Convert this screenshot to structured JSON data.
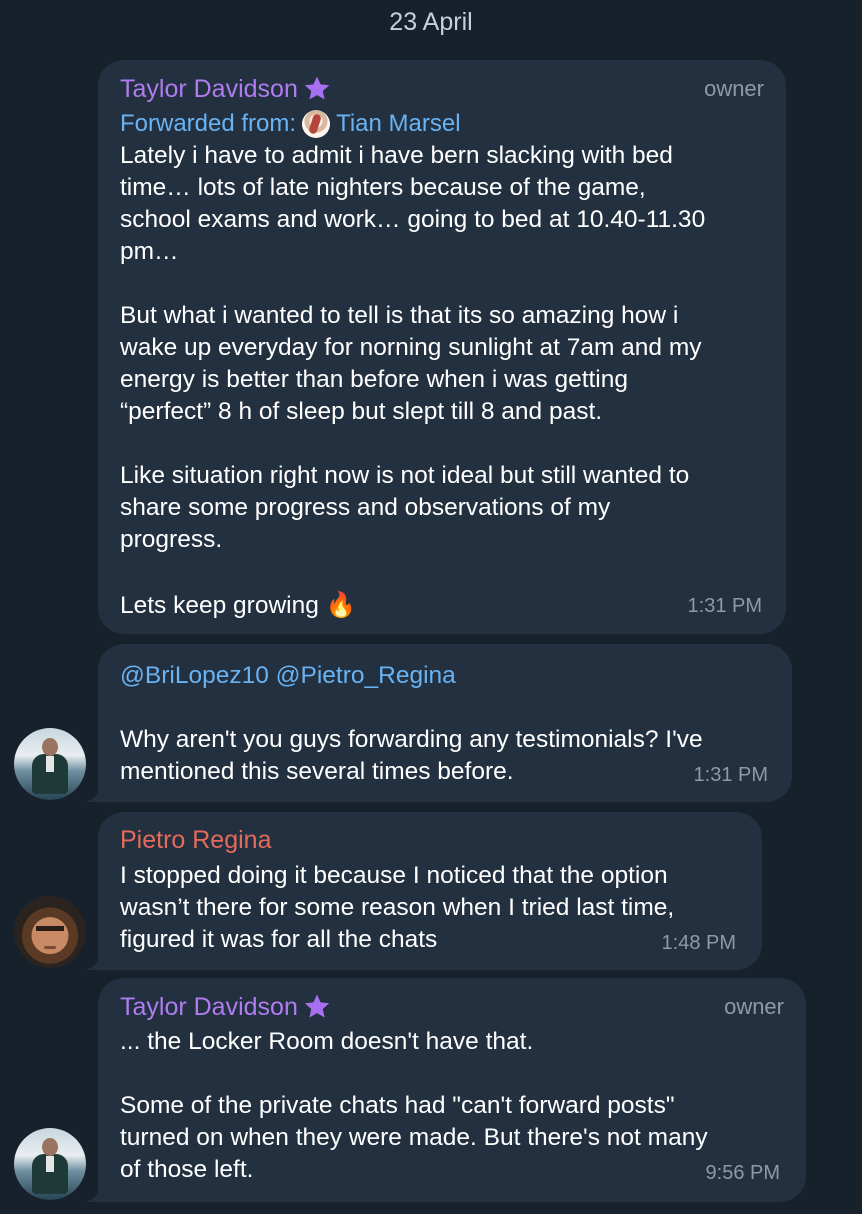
{
  "date_separator": "23 April",
  "messages": [
    {
      "sender": "Taylor Davidson",
      "role": "owner",
      "forwarded_label": "Forwarded from:",
      "forwarded_from": "Tian Marsel",
      "lines": [
        "Lately i have to admit i have bern slacking with  bed",
        "time… lots of late nighters because of the game,",
        "school exams and work… going to bed at 10.40-11.30",
        "pm…",
        "",
        "But what i wanted to tell is that its so amazing how i",
        "wake up everyday for norning sunlight at 7am and my",
        "energy is better than before when i was getting",
        "“perfect” 8 h of sleep but slept till 8 and past.",
        "",
        "Like situation right now is not ideal but still wanted to",
        "share some progress and observations of my",
        "progress.",
        "",
        "Lets keep growing 🔥"
      ],
      "time": "1:31 PM"
    },
    {
      "mentions": "@BriLopez10 @Pietro_Regina",
      "lines": [
        "Why aren't you guys forwarding any testimonials? I've",
        "mentioned this several times before."
      ],
      "time": "1:31 PM"
    },
    {
      "sender": "Pietro Regina",
      "lines": [
        "I stopped doing it because I noticed that the option",
        "wasn’t there for some reason when I tried last time,",
        "figured it was for all the chats"
      ],
      "time": "1:48 PM"
    },
    {
      "sender": "Taylor Davidson",
      "role": "owner",
      "lines": [
        "... the Locker Room doesn't have that.",
        "",
        "Some of the private chats had \"can't forward posts\"",
        "turned on when they were made.  But there's not many",
        "of those left."
      ],
      "time": "9:56 PM"
    }
  ],
  "colors": {
    "background": "#17212b",
    "bubble": "#22303f",
    "owner_name": "#b07cf0",
    "pietro_name": "#e56a5c",
    "link": "#6ab3f3",
    "meta": "#8e9aa6"
  },
  "icons": {
    "badge": "star-icon",
    "fire": "fire-emoji"
  }
}
